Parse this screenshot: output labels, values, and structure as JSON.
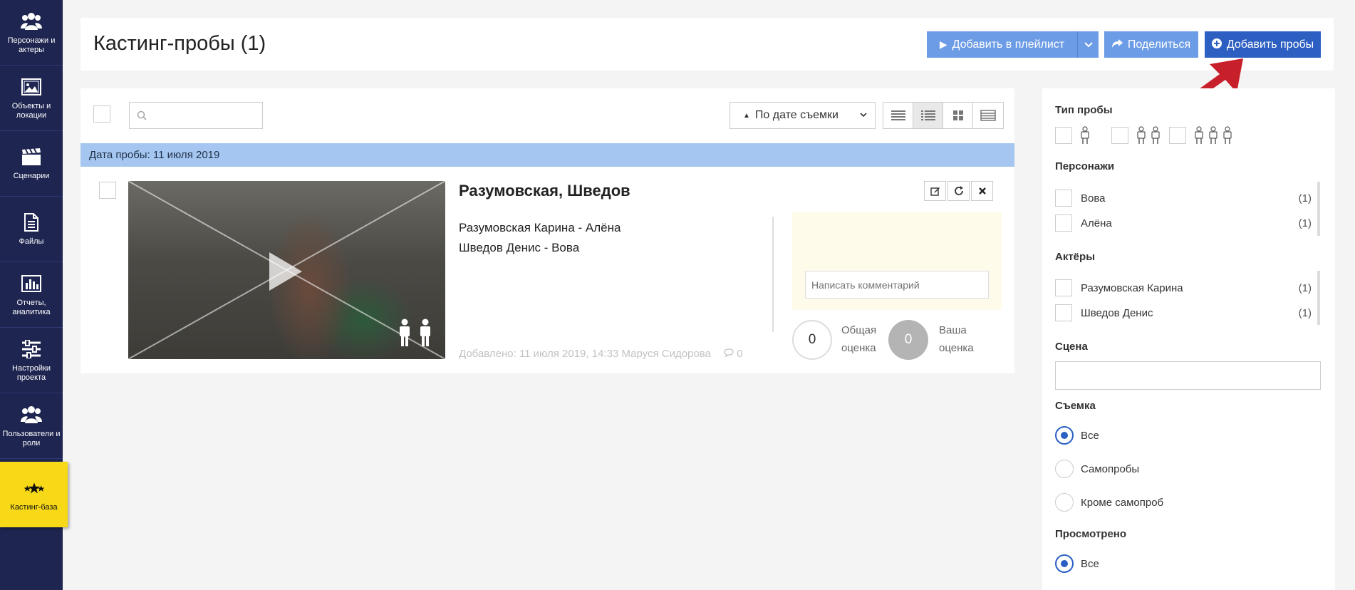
{
  "sidebar": {
    "items": [
      {
        "label": "Персонажи и актеры",
        "icon": "users-icon"
      },
      {
        "label": "Объекты и локации",
        "icon": "image-icon"
      },
      {
        "label": "Сценарии",
        "icon": "clapperboard-icon"
      },
      {
        "label": "Файлы",
        "icon": "file-icon"
      },
      {
        "label": "Отчеты, аналитика",
        "icon": "bar-chart-icon"
      },
      {
        "label": "Настройки проекта",
        "icon": "sliders-icon"
      },
      {
        "label": "Пользователи и роли",
        "icon": "users-icon"
      },
      {
        "label": "Кастинг-база",
        "icon": "stars-icon",
        "active": true
      }
    ]
  },
  "header": {
    "title": "Кастинг-пробы (1)",
    "add_playlist_label": "Добавить в плейлист",
    "share_label": "Поделиться",
    "add_tests_label": "Добавить пробы"
  },
  "toolbar": {
    "search_placeholder": "",
    "sort_label": "По дате съемки"
  },
  "group": {
    "date_label": "Дата пробы: 11 июля 2019"
  },
  "card": {
    "title": "Разумовская, Шведов",
    "cast": [
      "Разумовская Карина - Алёна",
      "Шведов Денис - Вова"
    ],
    "added": "Добавлено: 11 июля 2019, 14:33",
    "author": "Маруся Сидорова",
    "comments_count": "0",
    "comment_placeholder": "Написать комментарий",
    "total_score": "0",
    "total_score_label_1": "Общая",
    "total_score_label_2": "оценка",
    "your_score": "0",
    "your_score_label_1": "Ваша",
    "your_score_label_2": "оценка"
  },
  "filters": {
    "type_title": "Тип пробы",
    "characters_title": "Персонажи",
    "characters": [
      {
        "label": "Вова",
        "count": "(1)"
      },
      {
        "label": "Алёна",
        "count": "(1)"
      }
    ],
    "actors_title": "Актёры",
    "actors": [
      {
        "label": "Разумовская Карина",
        "count": "(1)"
      },
      {
        "label": "Шведов Денис",
        "count": "(1)"
      }
    ],
    "scene_title": "Сцена",
    "shoot_title": "Съемка",
    "shoot_options": [
      "Все",
      "Самопробы",
      "Кроме самопроб"
    ],
    "viewed_title": "Просмотрено",
    "viewed_options": [
      "Все"
    ]
  },
  "colors": {
    "sidebar": "#1e2550",
    "active_item": "#f7d917",
    "primary": "#2d5fc2",
    "secondary": "#6d9ce6",
    "date_bar": "#a4c6f0",
    "arrow": "#c8202a"
  }
}
